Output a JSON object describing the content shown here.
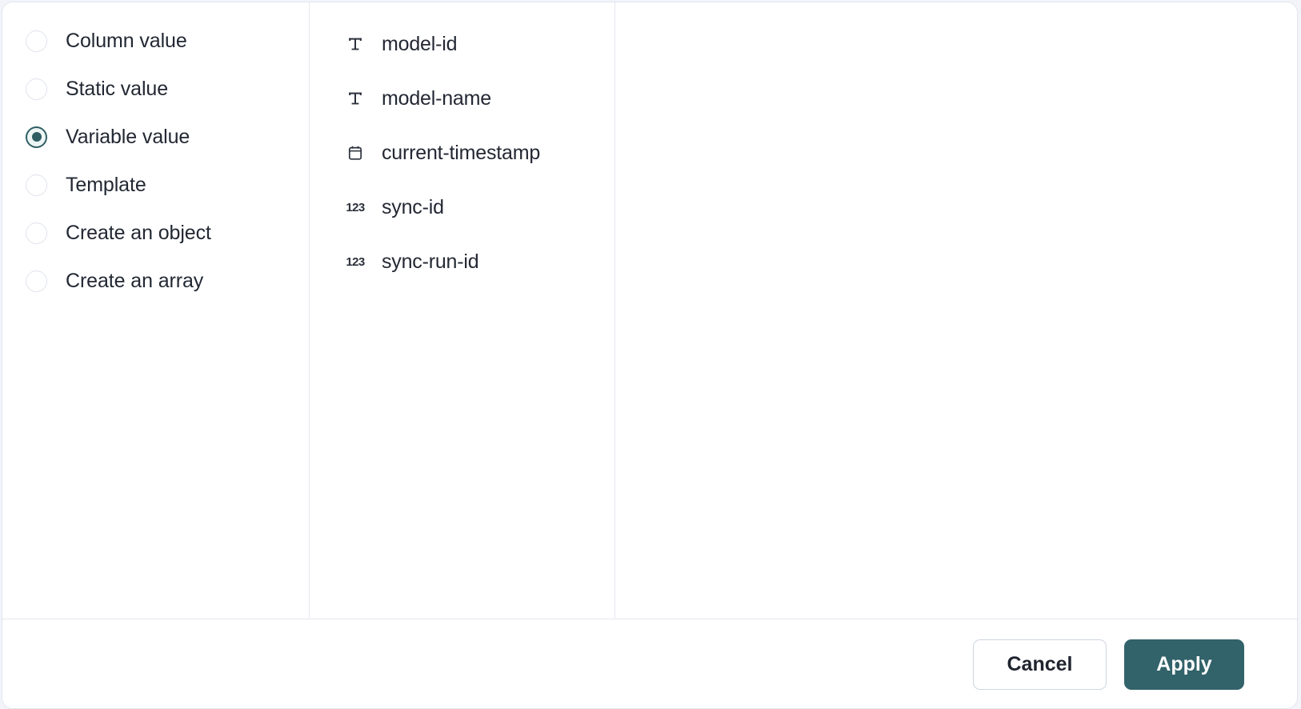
{
  "dialog": {
    "source_column": {
      "options": [
        {
          "label": "Column value",
          "selected": false
        },
        {
          "label": "Static value",
          "selected": false
        },
        {
          "label": "Variable value",
          "selected": true
        },
        {
          "label": "Template",
          "selected": false
        },
        {
          "label": "Create an object",
          "selected": false
        },
        {
          "label": "Create an array",
          "selected": false
        }
      ]
    },
    "variable_column": {
      "items": [
        {
          "label": "model-id",
          "icon": "text-type-icon",
          "icon_glyph": "T"
        },
        {
          "label": "model-name",
          "icon": "text-type-icon",
          "icon_glyph": "T"
        },
        {
          "label": "current-timestamp",
          "icon": "calendar-icon",
          "icon_glyph": ""
        },
        {
          "label": "sync-id",
          "icon": "number-type-icon",
          "icon_glyph": "123"
        },
        {
          "label": "sync-run-id",
          "icon": "number-type-icon",
          "icon_glyph": "123"
        }
      ]
    },
    "detail_column": {
      "content": ""
    },
    "footer": {
      "cancel_label": "Cancel",
      "apply_label": "Apply"
    }
  },
  "colors": {
    "accent": "#32626a",
    "radio_selected_ring": "#2e5e62",
    "radio_selected_fill": "#eef6f5",
    "text": "#232833",
    "border": "#e5e8ef",
    "page_background": "#f3f4f9"
  }
}
